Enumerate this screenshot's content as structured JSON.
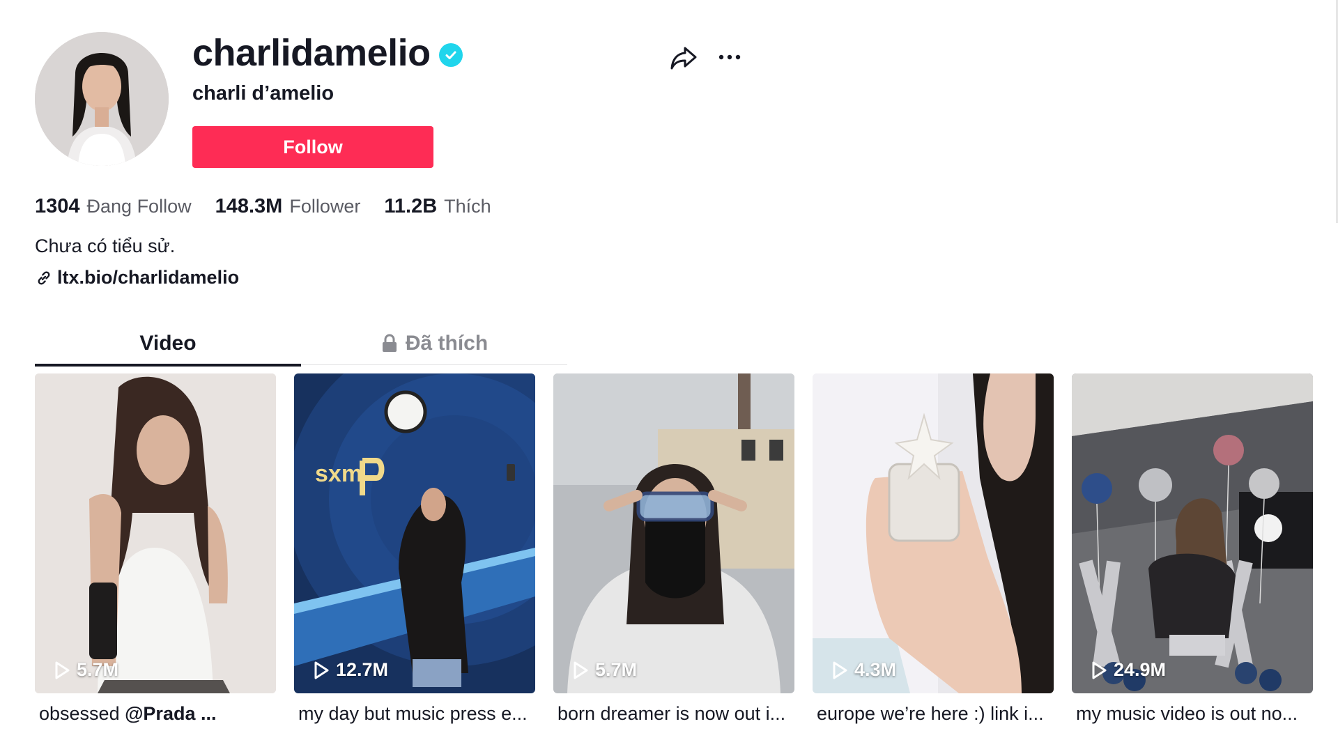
{
  "profile": {
    "username": "charlidamelio",
    "nickname": "charli d’amelio",
    "follow_label": "Follow",
    "bio": "Chưa có tiểu sử.",
    "link": "ltx.bio/charlidamelio"
  },
  "stats": {
    "following_count": "1304",
    "following_label": "Đang Follow",
    "followers_count": "148.3M",
    "followers_label": "Follower",
    "likes_count": "11.2B",
    "likes_label": "Thích"
  },
  "tabs": [
    {
      "label": "Video",
      "active": true
    },
    {
      "label": "Đã thích",
      "active": false,
      "locked": true
    }
  ],
  "videos": [
    {
      "views": "5.7M",
      "caption_text": "obsessed ",
      "caption_mention": "@Prada ..."
    },
    {
      "views": "12.7M",
      "caption_text": "my day but music press e...",
      "caption_mention": ""
    },
    {
      "views": "5.7M",
      "caption_text": "born dreamer is now out i...",
      "caption_mention": ""
    },
    {
      "views": "4.3M",
      "caption_text": "europe we’re here :) link i...",
      "caption_mention": ""
    },
    {
      "views": "24.9M",
      "caption_text": "my music video is out no...",
      "caption_mention": ""
    }
  ],
  "icons": {
    "verified": "verified-badge-icon",
    "share": "share-arrow-icon",
    "more": "more-dots-icon",
    "link": "link-chain-icon",
    "lock": "lock-icon",
    "play": "play-icon"
  },
  "colors": {
    "follow_button": "#fe2c55",
    "verified": "#20d5ec",
    "text_primary": "#161823",
    "text_secondary": "#5a5b63",
    "tab_inactive": "#8a8b91"
  }
}
